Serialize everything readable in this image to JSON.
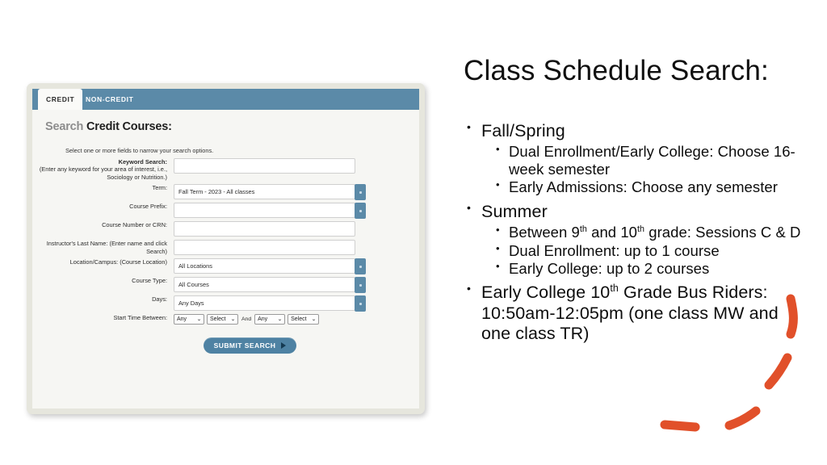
{
  "slide": {
    "title": "Class Schedule Search:",
    "background": "#ffffff",
    "annotation_color": "#e1502a"
  },
  "screenshot": {
    "tabs": [
      {
        "label": "CREDIT",
        "active": true
      },
      {
        "label": "NON-CREDIT",
        "active": false
      }
    ],
    "heading_light": "Search ",
    "heading_bold": "Credit Courses:",
    "instruction": "Select one or more fields to narrow your search options.",
    "accent_blue": "#5b8aa8",
    "fields": [
      {
        "label_bold": "Keyword Search:",
        "label_note": "(Enter any keyword for your area of interest, i.e., Sociology or Nutrition.)",
        "type": "text",
        "value": "",
        "tall": true
      },
      {
        "label": "Term:",
        "type": "select",
        "value": "Fall Term - 2023 - All classes"
      },
      {
        "label": "Course Prefix:",
        "type": "select",
        "value": ""
      },
      {
        "label": "Course Number or CRN:",
        "type": "text",
        "value": ""
      },
      {
        "label": "Instructor's Last Name: (Enter name and click Search)",
        "type": "text",
        "value": ""
      },
      {
        "label": "Location/Campus: (Course Location)",
        "type": "select",
        "value": "All Locations"
      },
      {
        "label": "Course Type:",
        "type": "select",
        "value": "All Courses"
      },
      {
        "label": "Days:",
        "type": "select",
        "value": "Any Days"
      }
    ],
    "start_time": {
      "label": "Start Time Between:",
      "from_hour": "Any",
      "from_period": "Select",
      "conjunction": "And",
      "to_hour": "Any",
      "to_period": "Select"
    },
    "submit_label": "SUBMIT SEARCH"
  },
  "bullets": {
    "fall_spring": "Fall/Spring",
    "fall_spring_sub_1": "Dual Enrollment/Early College: Choose 16-week semester",
    "fall_spring_sub_2": "Early Admissions: Choose any semester",
    "summer": "Summer",
    "summer_sub_1_a": "Between 9",
    "summer_sub_1_sup1": "th",
    "summer_sub_1_b": " and 10",
    "summer_sub_1_sup2": "th",
    "summer_sub_1_c": " grade: Sessions C & D",
    "summer_sub_2": "Dual Enrollment: up to 1 course",
    "summer_sub_3": "Early College: up to 2 courses",
    "bus_a": "Early College 10",
    "bus_sup": "th",
    "bus_b": " Grade Bus Riders: 10:50am-12:05pm (one class MW and one class TR)"
  }
}
